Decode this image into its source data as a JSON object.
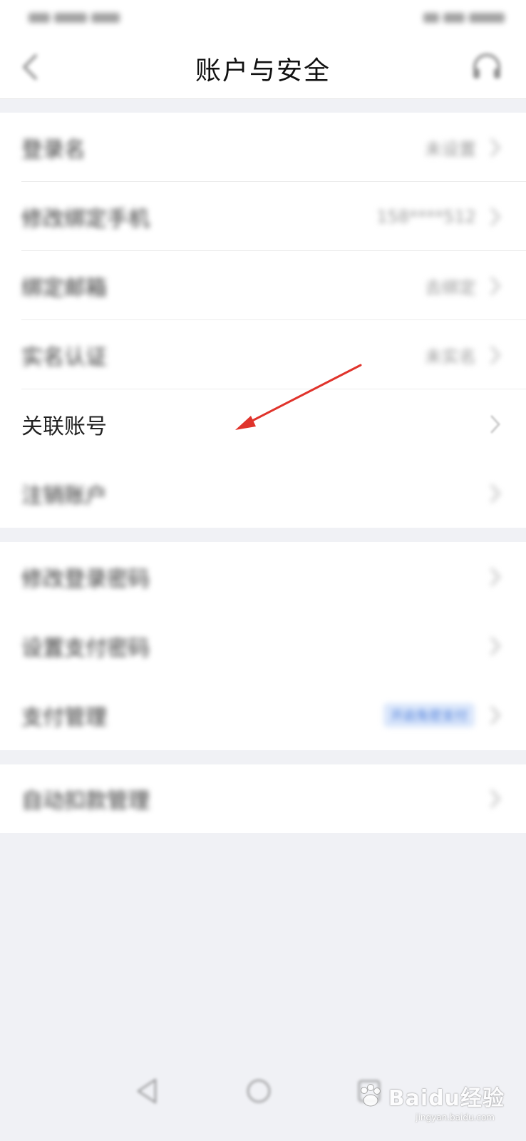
{
  "nav": {
    "title": "账户与安全"
  },
  "groups": [
    {
      "items": [
        {
          "label": "登录名",
          "value": "未设置"
        },
        {
          "label": "修改绑定手机",
          "value": "158****512"
        },
        {
          "label": "绑定邮箱",
          "value": "去绑定"
        },
        {
          "label": "实名认证",
          "value": "未实名"
        },
        {
          "label": "关联账号",
          "value": ""
        },
        {
          "label": "注销账户",
          "value": ""
        }
      ]
    },
    {
      "items": [
        {
          "label": "修改登录密码",
          "value": ""
        },
        {
          "label": "设置支付密码",
          "value": ""
        },
        {
          "label": "支付管理",
          "badge": "开启免密支付"
        }
      ]
    },
    {
      "items": [
        {
          "label": "自动扣款管理",
          "value": ""
        }
      ]
    }
  ],
  "colors": {
    "background": "#f0f1f5",
    "annotation_arrow": "#e0332b",
    "badge_text": "#4a7bd8"
  },
  "icons": {
    "back": "chevron-left-icon",
    "service": "headset-icon",
    "row_chevron": "chevron-right-icon"
  },
  "watermark": {
    "brand": "Baidu经验",
    "url": "jingyan.baidu.com"
  }
}
